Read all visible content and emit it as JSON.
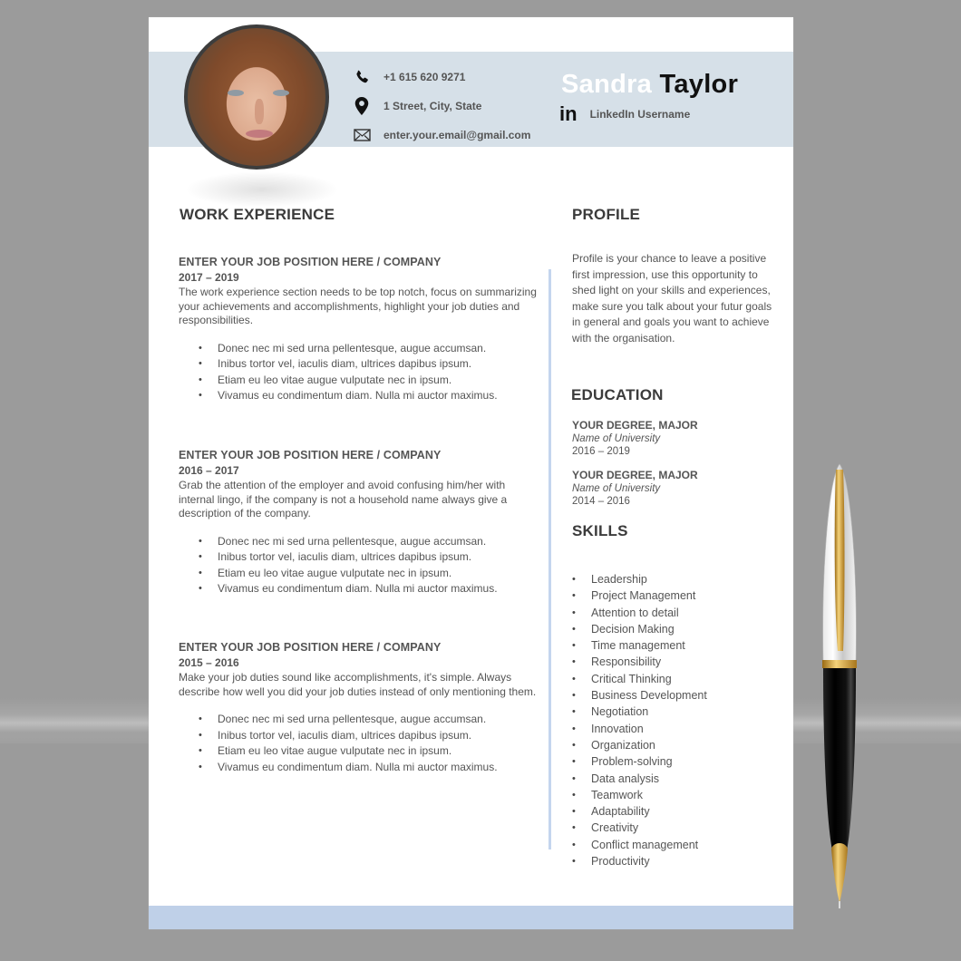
{
  "header": {
    "first_name": "Sandra",
    "last_name": "Taylor",
    "contacts": [
      {
        "icon": "phone-icon",
        "text": "+1 615 620 9271"
      },
      {
        "icon": "location-pin-icon",
        "text": "1 Street, City, State"
      },
      {
        "icon": "envelope-icon",
        "text": "enter.your.email@gmail.com"
      }
    ],
    "linkedin": {
      "icon": "linkedin-icon",
      "glyph": "in",
      "text": "LinkedIn Username"
    }
  },
  "work": {
    "title": "WORK EXPERIENCE",
    "jobs": [
      {
        "title": "ENTER YOUR JOB POSITION HERE / COMPANY",
        "dates": "2017 – 2019",
        "description": "The work experience section needs to be top notch, focus on summarizing your achievements and accomplishments, highlight your job duties and responsibilities.",
        "bullets": [
          "Donec nec mi sed urna pellentesque, augue accumsan.",
          "Inibus tortor vel, iaculis diam, ultrices dapibus ipsum.",
          "Etiam eu leo vitae augue vulputate nec in ipsum.",
          "Vivamus eu condimentum diam. Nulla mi auctor maximus."
        ]
      },
      {
        "title": "ENTER YOUR JOB POSITION HERE / COMPANY",
        "dates": "2016 – 2017",
        "description": "Grab the attention of the employer and avoid confusing him/her with internal lingo, if the company is not a household name always give a description of the company.",
        "bullets": [
          "Donec nec mi sed urna pellentesque, augue accumsan.",
          "Inibus tortor vel, iaculis diam, ultrices dapibus ipsum.",
          "Etiam eu leo vitae augue vulputate nec in ipsum.",
          "Vivamus eu condimentum diam. Nulla mi auctor maximus."
        ]
      },
      {
        "title": "ENTER YOUR JOB POSITION HERE / COMPANY",
        "dates": "2015 – 2016",
        "description": "Make your job duties sound like accomplishments, it's simple. Always describe how well you did your job duties instead of only mentioning them.",
        "bullets": [
          "Donec nec mi sed urna pellentesque, augue accumsan.",
          "Inibus tortor vel, iaculis diam, ultrices dapibus ipsum.",
          "Etiam eu leo vitae augue vulputate nec in ipsum.",
          "Vivamus eu condimentum diam. Nulla mi auctor maximus."
        ]
      }
    ]
  },
  "profile": {
    "title": "PROFILE",
    "text": "Profile is your chance to leave a positive first impression, use this opportunity to shed light on your skills and experiences, make sure you talk about your futur goals in general and goals you want to achieve with the organisation."
  },
  "education": {
    "title": "EDUCATION",
    "items": [
      {
        "degree": "YOUR DEGREE, MAJOR",
        "university": "Name of University",
        "dates": "2016 – 2019"
      },
      {
        "degree": "YOUR DEGREE, MAJOR",
        "university": "Name of University",
        "dates": "2014 – 2016"
      }
    ]
  },
  "skills": {
    "title": "SKILLS",
    "items": [
      "Leadership",
      "Project Management",
      "Attention to detail",
      "Decision Making",
      "Time management",
      "Responsibility",
      "Critical Thinking",
      "Business Development",
      "Negotiation",
      "Innovation",
      "Organization",
      "Problem-solving",
      "Data analysis",
      "Teamwork",
      "Adaptability",
      "Creativity",
      "Conflict management",
      "Productivity"
    ]
  },
  "colors": {
    "header_band": "#d6e0e8",
    "footer_band": "#bfd0e8",
    "divider": "#c4d5ee",
    "background": "#9b9b9b"
  }
}
